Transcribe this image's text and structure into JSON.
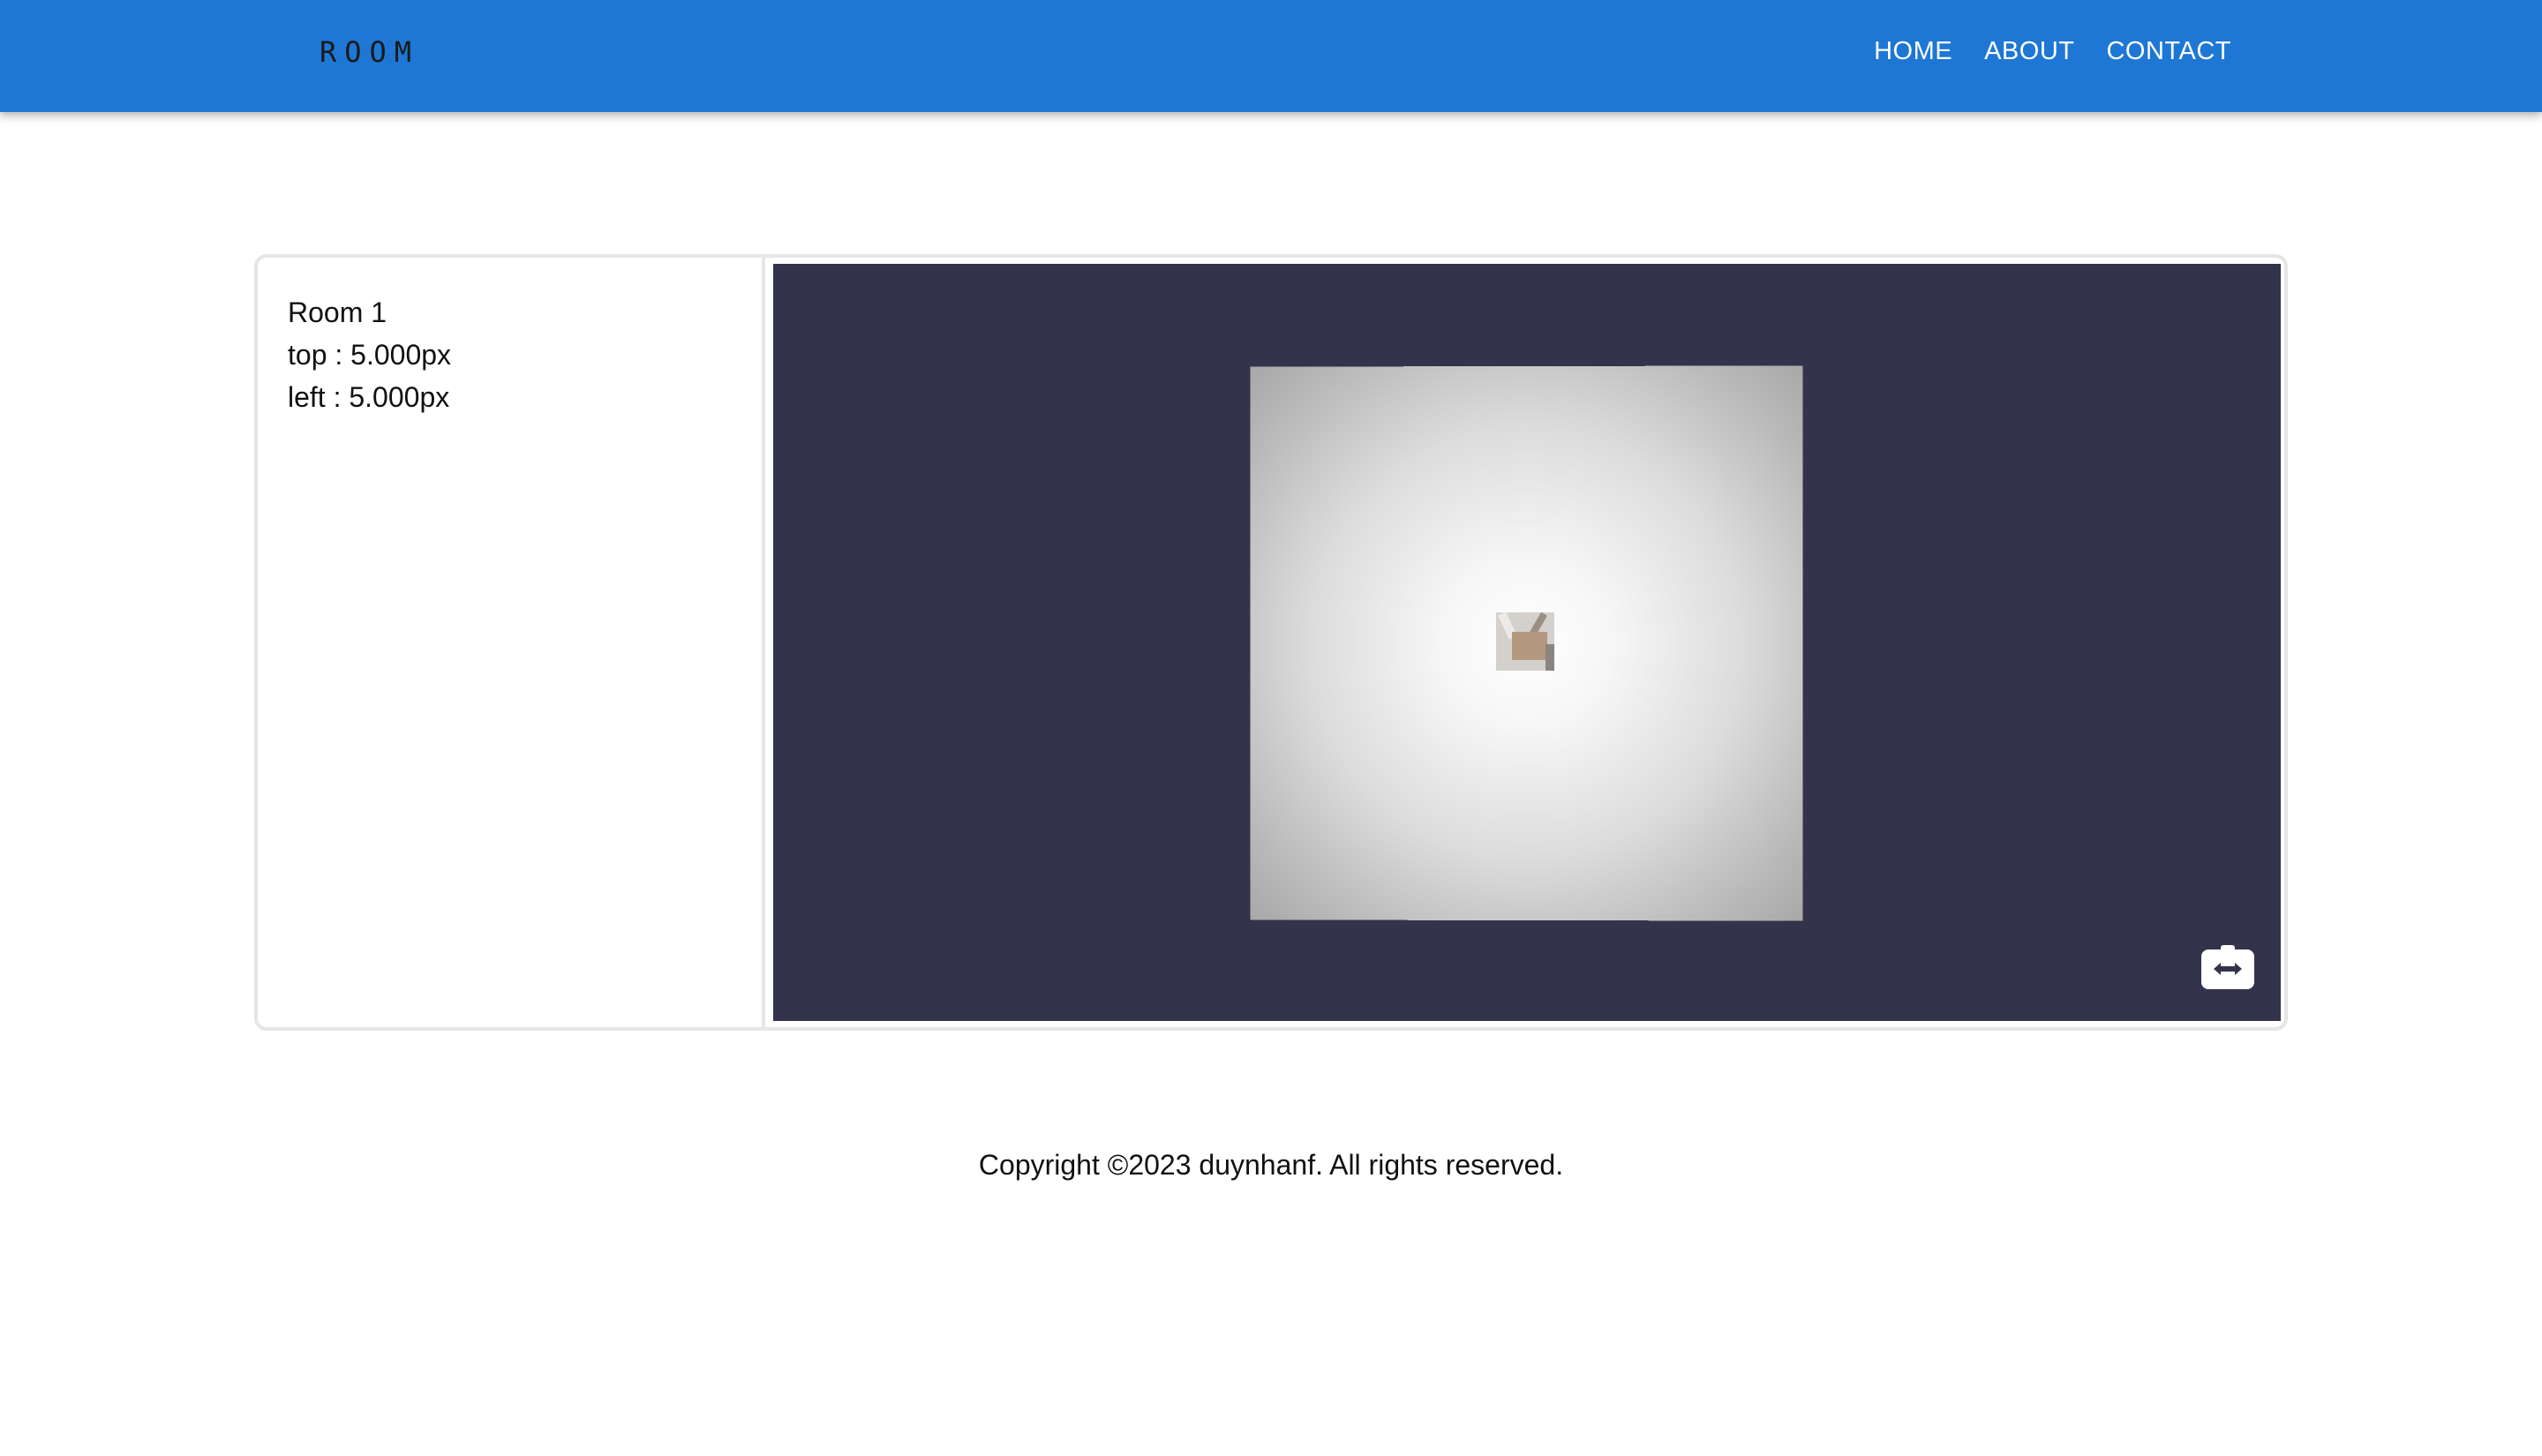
{
  "header": {
    "logo": "ROOM",
    "nav": [
      {
        "label": "HOME"
      },
      {
        "label": "ABOUT"
      },
      {
        "label": "CONTACT"
      }
    ],
    "background_color": "#1e77d4"
  },
  "room_info": {
    "name": "Room 1",
    "top": "top : 5.000px",
    "left": "left : 5.000px"
  },
  "viewer": {
    "background_color": "#34334c",
    "camera_button_icon": "camera-switch-icon"
  },
  "footer": {
    "copyright": "Copyright ©2023 duynhanf. All rights reserved."
  }
}
